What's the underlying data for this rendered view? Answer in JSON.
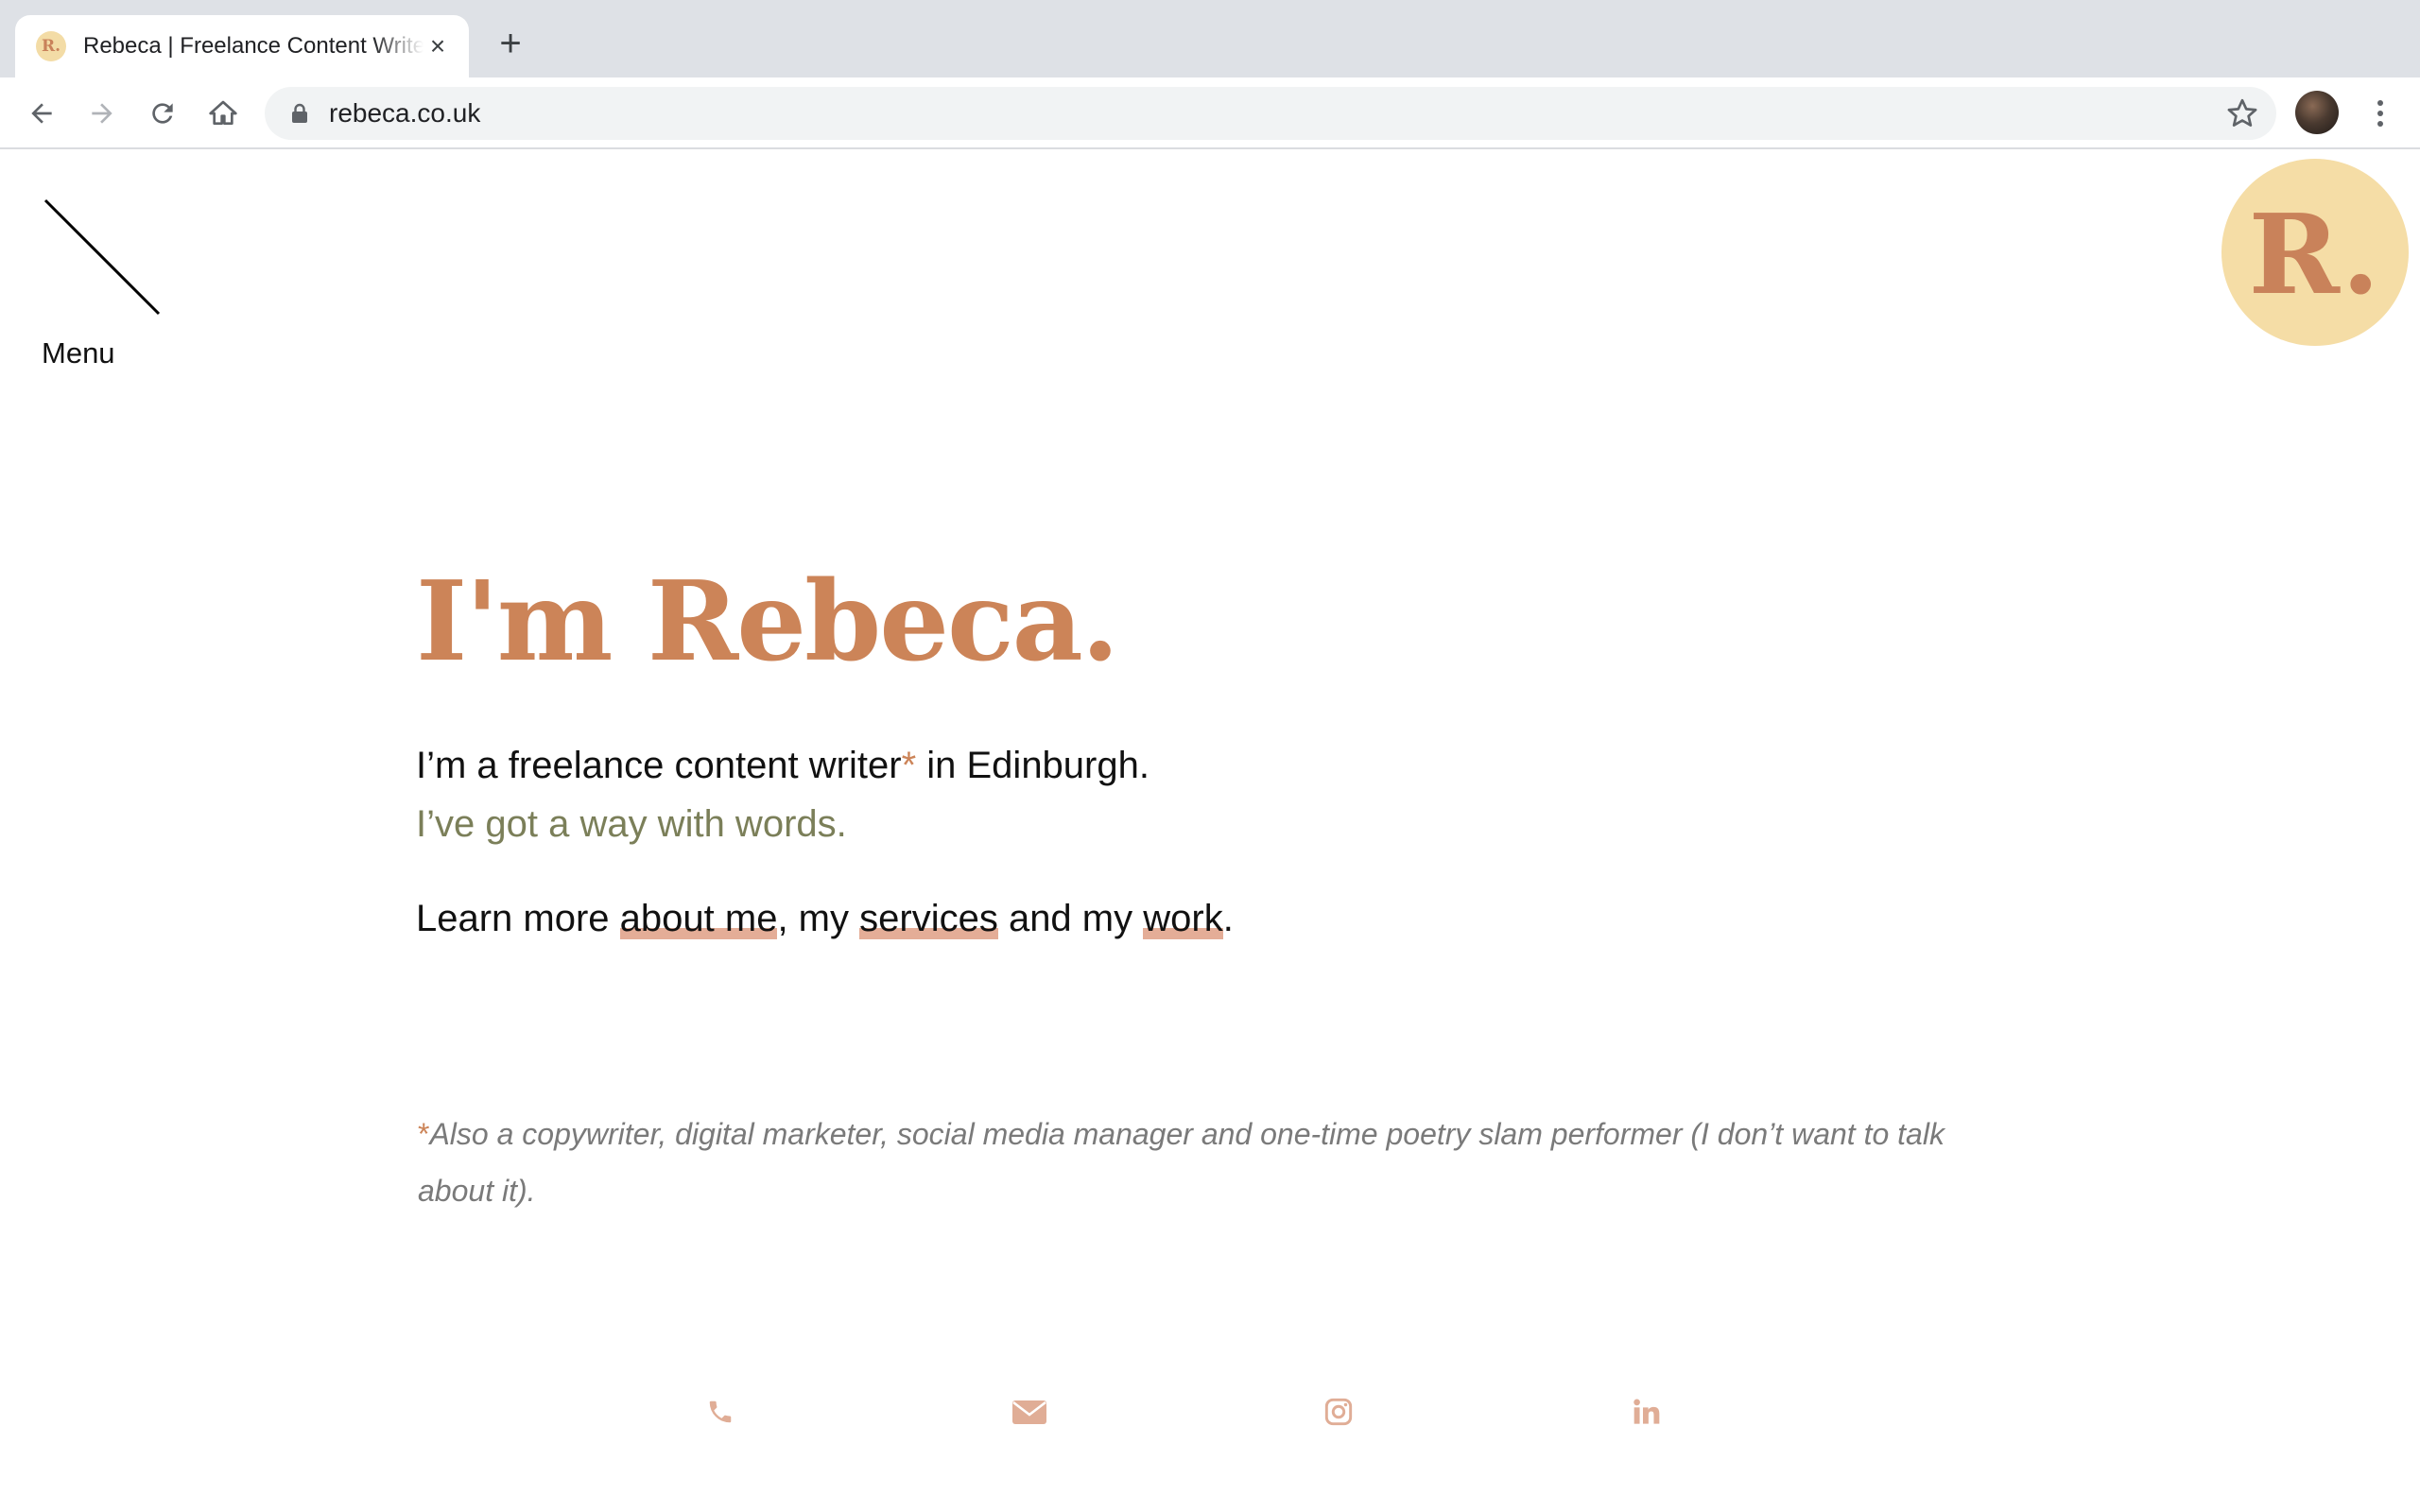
{
  "browser": {
    "tab": {
      "favicon": "R.",
      "title": "Rebeca | Freelance Content Writer"
    },
    "url": "rebeca.co.uk",
    "icons": {
      "back": "arrow-left-icon",
      "forward": "arrow-right-icon",
      "reload": "reload-icon",
      "home": "home-icon",
      "lock": "lock-icon",
      "bookmark": "star-icon",
      "menu": "more-vert-icon"
    }
  },
  "site": {
    "menu_label": "Menu",
    "logo": "R.",
    "headline": "I'm Rebeca.",
    "intro": {
      "before": "I’m a freelance content writer",
      "asterisk": "*",
      "after": " in Edinburgh."
    },
    "tagline": "I’ve got a way with words.",
    "learn": {
      "prefix": "Learn more ",
      "about": "about me",
      "sep1": ", my ",
      "services": "services",
      "sep2": " and my ",
      "work": "work",
      "end": "."
    },
    "footnote": {
      "asterisk": "*",
      "text": "Also a copywriter, digital marketer, social media manager and one-time poetry slam performer (I don’t want to talk about it)."
    },
    "social": [
      "phone-icon",
      "email-icon",
      "instagram-icon",
      "linkedin-icon"
    ]
  },
  "colors": {
    "accent": "#cc8458",
    "logo_bg": "#f5dda6",
    "tagline": "#7b7f59",
    "link_underline": "#e4ad97",
    "footnote": "#7a7a7a"
  }
}
